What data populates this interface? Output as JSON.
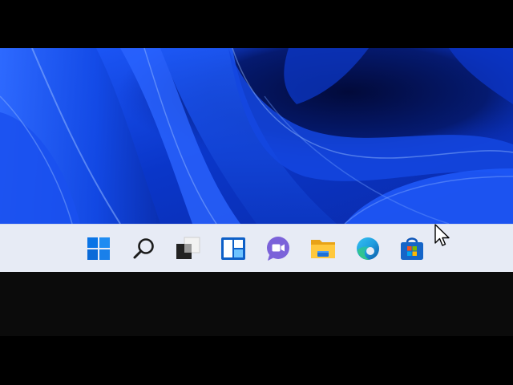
{
  "desktop": {
    "wallpaper": "windows-11-bloom",
    "colors": {
      "deep": "#06144f",
      "mid": "#0b3fd8",
      "light": "#3f7dff",
      "highlight": "#8fb6ff"
    }
  },
  "taskbar": {
    "background": "#e7ebf5",
    "items": [
      {
        "icon": "windows-start-icon"
      },
      {
        "icon": "search-icon"
      },
      {
        "icon": "task-view-icon"
      },
      {
        "icon": "widgets-icon"
      },
      {
        "icon": "teams-chat-icon"
      },
      {
        "icon": "file-explorer-icon"
      },
      {
        "icon": "edge-icon"
      },
      {
        "icon": "microsoft-store-icon"
      }
    ]
  },
  "cursor": {
    "icon": "mouse-pointer-icon"
  }
}
